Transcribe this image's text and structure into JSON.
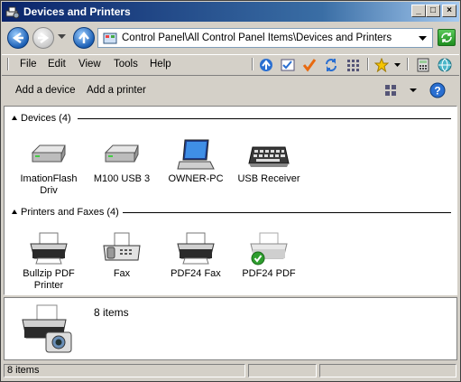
{
  "window": {
    "title": "Devices and Printers"
  },
  "title_buttons": {
    "minimize": "_",
    "maximize": "□",
    "close": "×"
  },
  "address": {
    "path": "Control Panel\\All Control Panel Items\\Devices and Printers"
  },
  "menu": [
    "File",
    "Edit",
    "View",
    "Tools",
    "Help"
  ],
  "commands": {
    "add_device": "Add a device",
    "add_printer": "Add a printer"
  },
  "groups": {
    "devices": {
      "label": "Devices (4)",
      "items": [
        {
          "label": "ImationFlash Driv",
          "icon": "usb-drive-icon"
        },
        {
          "label": "M100 USB 3",
          "icon": "usb-drive-icon"
        },
        {
          "label": "OWNER-PC",
          "icon": "laptop-icon"
        },
        {
          "label": "USB Receiver",
          "icon": "keyboard-icon"
        }
      ]
    },
    "printers": {
      "label": "Printers and Faxes (4)",
      "items": [
        {
          "label": "Bullzip PDF Printer",
          "icon": "printer-icon"
        },
        {
          "label": "Fax",
          "icon": "fax-icon"
        },
        {
          "label": "PDF24 Fax",
          "icon": "printer-icon"
        },
        {
          "label": "PDF24 PDF",
          "icon": "printer-default-icon"
        }
      ]
    }
  },
  "details": {
    "count": "8 items"
  },
  "status": {
    "items": "8 items"
  }
}
